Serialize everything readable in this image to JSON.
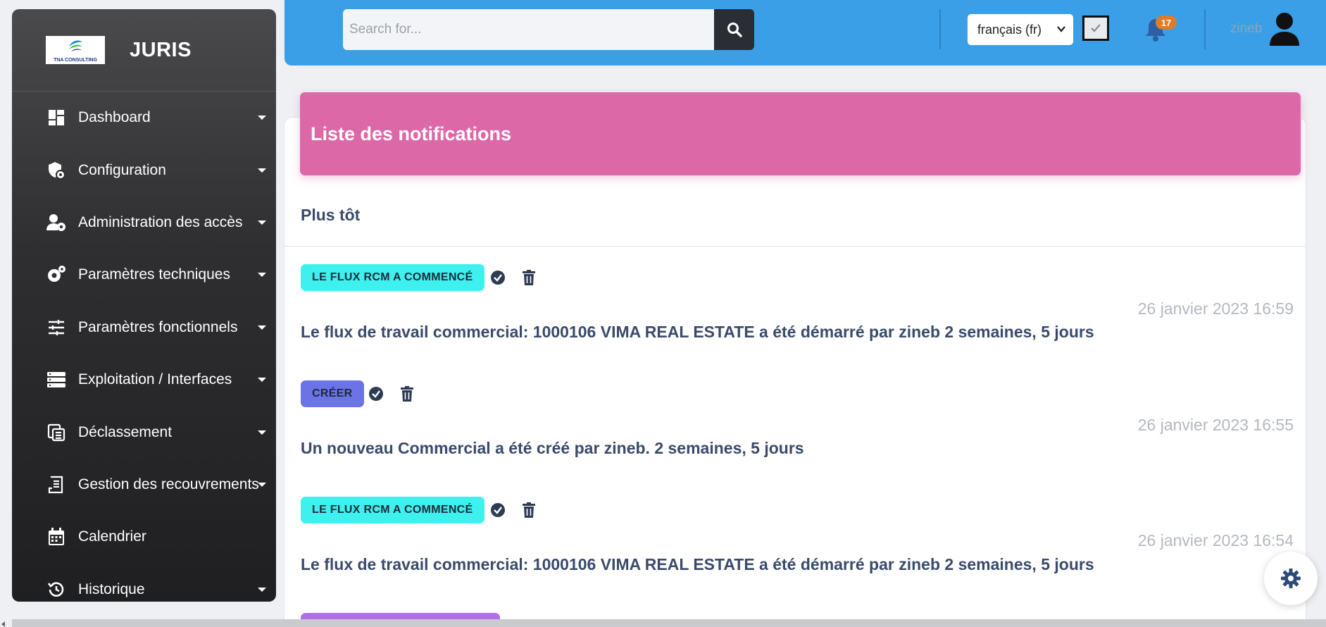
{
  "sidebar": {
    "brand": {
      "logo_text": "TNA CONSULTING",
      "title": "JURIS"
    },
    "items": [
      {
        "label": "Dashboard",
        "icon": "dashboard-icon",
        "has_caret": true
      },
      {
        "label": "Configuration",
        "icon": "shield-cog-icon",
        "has_caret": true
      },
      {
        "label": "Administration des accès",
        "icon": "user-cog-icon",
        "has_caret": true
      },
      {
        "label": "Paramètres techniques",
        "icon": "gears-icon",
        "has_caret": true
      },
      {
        "label": "Paramètres fonctionnels",
        "icon": "sliders-icon",
        "has_caret": true
      },
      {
        "label": "Exploitation / Interfaces",
        "icon": "server-icon",
        "has_caret": true
      },
      {
        "label": "Déclassement",
        "icon": "archive-icon",
        "has_caret": true
      },
      {
        "label": "Gestion des recouvrements",
        "icon": "receipt-icon",
        "has_caret": true
      },
      {
        "label": "Calendrier",
        "icon": "calendar-icon",
        "has_caret": false
      },
      {
        "label": "Historique",
        "icon": "history-icon",
        "has_caret": true
      }
    ]
  },
  "topbar": {
    "search": {
      "placeholder": "Search for..."
    },
    "language": {
      "selected": "français (fr)"
    },
    "notifications_count": "17",
    "user": {
      "name": "zineb"
    }
  },
  "main": {
    "title": "Liste des notifications",
    "section": "Plus tôt",
    "notifications": [
      {
        "tag": "LE FLUX RCM A COMMENCÉ",
        "tag_color": "#3ef0ee",
        "date": "26 janvier 2023 16:59",
        "message": "Le flux de travail commercial: 1000106 VIMA REAL ESTATE a été démarré par zineb 2 semaines, 5 jours"
      },
      {
        "tag": "CRÉER",
        "tag_color": "#6b73e6",
        "date": "26 janvier 2023 16:55",
        "message": "Un nouveau Commercial a été créé par zineb. 2 semaines, 5 jours"
      },
      {
        "tag": "LE FLUX RCM A COMMENCÉ",
        "tag_color": "#3ef0ee",
        "date": "26 janvier 2023 16:54",
        "message": "Le flux de travail commercial: 1000106 VIMA REAL ESTATE a été démarré par zineb 2 semaines, 5 jours"
      }
    ]
  },
  "colors": {
    "topbar": "#3a9fe6",
    "header": "#dc68a8",
    "text": "#3a4a6b",
    "badge": "#e07b28"
  }
}
